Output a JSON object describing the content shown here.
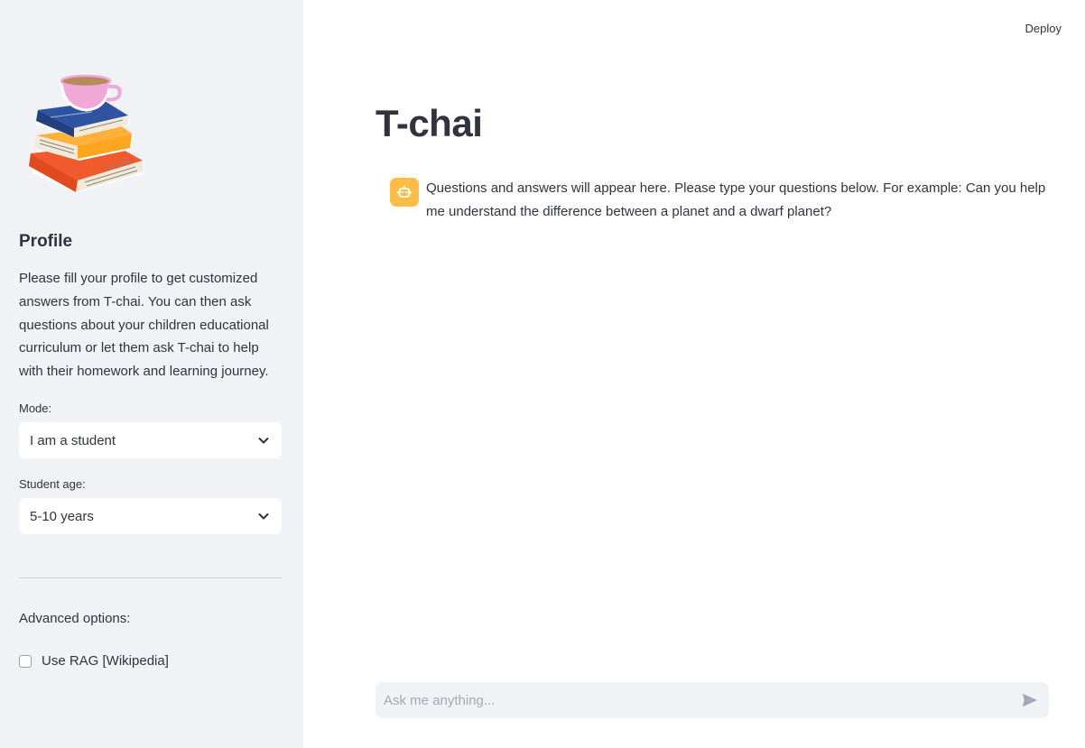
{
  "sidebar": {
    "profile_title": "Profile",
    "profile_description": "Please fill your profile to get customized answers from T-chai. You can then ask questions about your children educational curriculum or let them ask T-chai to help with their homework and learning journey.",
    "mode": {
      "label": "Mode:",
      "value": "I am a student"
    },
    "age": {
      "label": "Student age:",
      "value": "5-10 years"
    },
    "advanced_label": "Advanced options:",
    "rag_checkbox": {
      "label": "Use RAG [Wikipedia]",
      "checked": false
    }
  },
  "header": {
    "deploy_label": "Deploy"
  },
  "main": {
    "title": "T-chai",
    "messages": [
      {
        "role": "assistant",
        "text": "Questions and answers will appear here. Please type your questions below. For example: Can you help me understand the difference between a planet and a dwarf planet?"
      }
    ],
    "chat_input": {
      "placeholder": "Ask me anything..."
    }
  },
  "colors": {
    "sidebar_bg": "#f0f2f6",
    "avatar_bg": "#ffbd45",
    "text": "#31333f"
  },
  "icons": {
    "logo": "books-and-teacup-logo",
    "select_arrow": "chevron-down-icon",
    "avatar": "robot-icon",
    "send": "send-icon"
  }
}
